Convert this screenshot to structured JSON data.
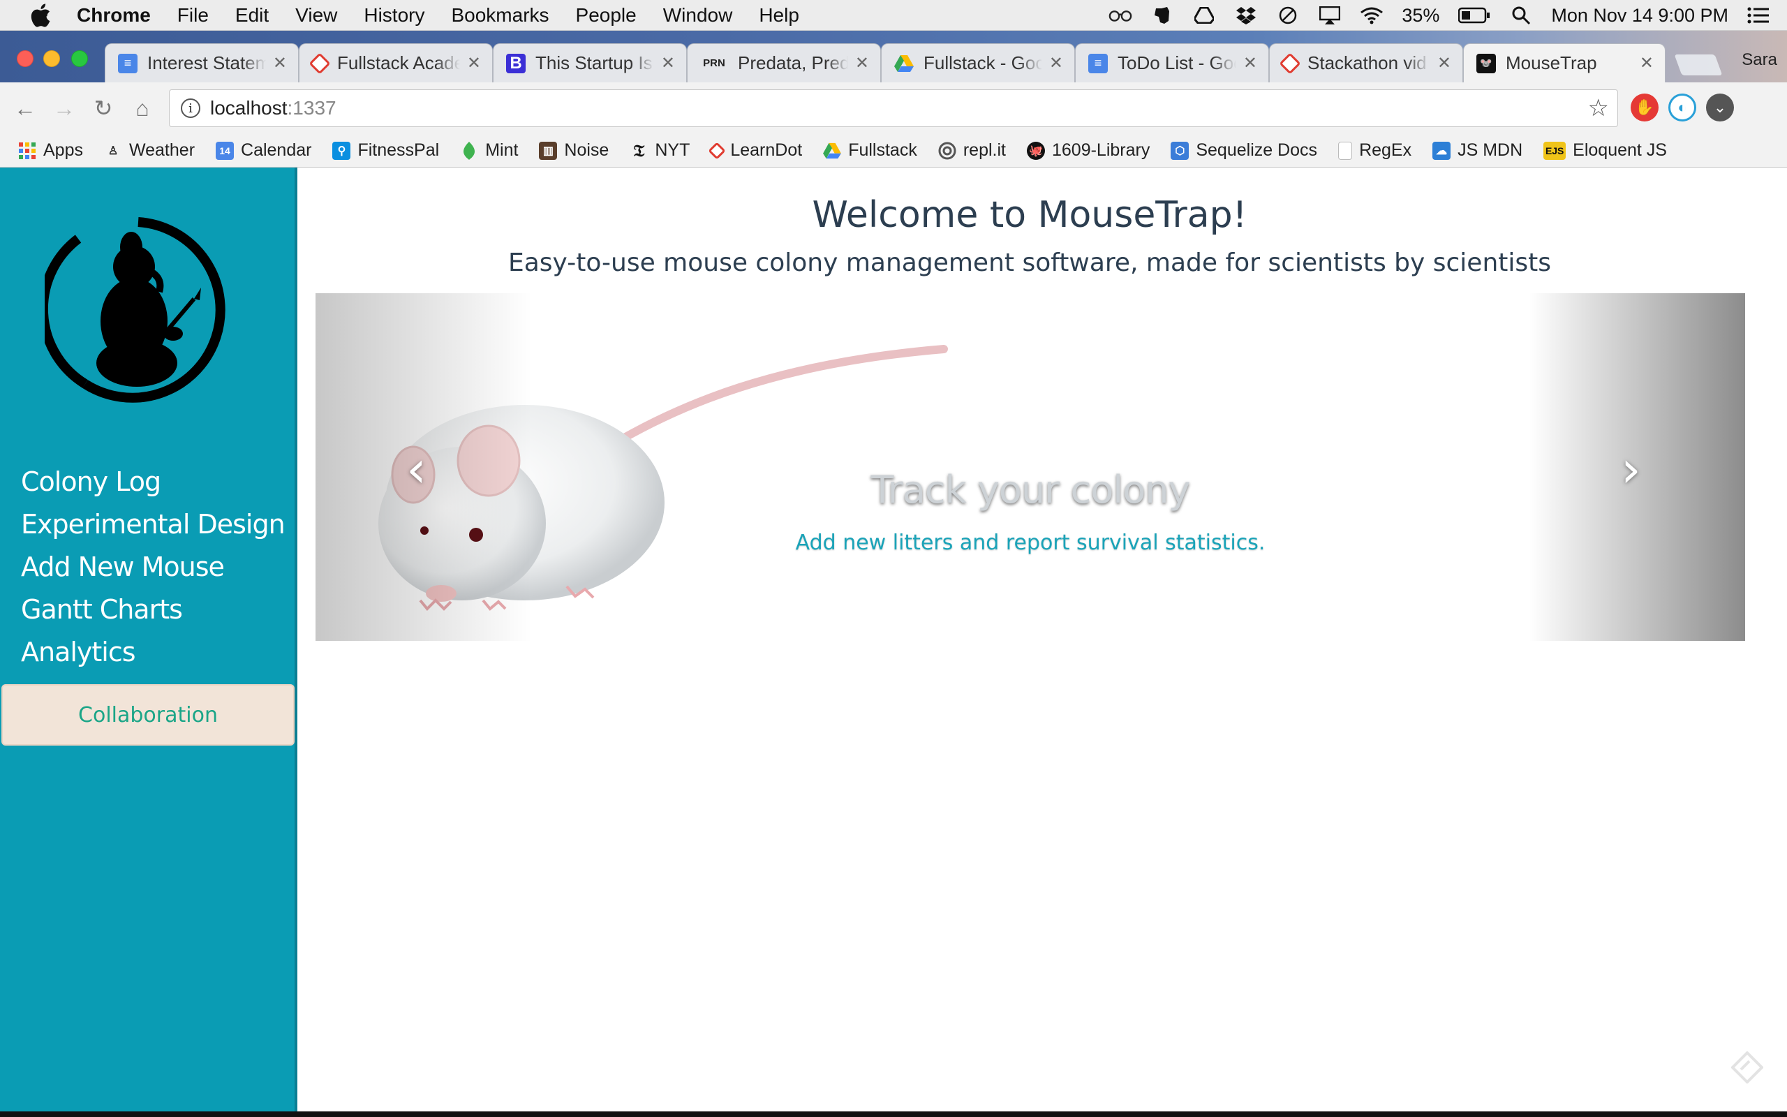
{
  "menubar": {
    "items": [
      "Chrome",
      "File",
      "Edit",
      "View",
      "History",
      "Bookmarks",
      "People",
      "Window",
      "Help"
    ],
    "battery": "35%",
    "clock": "Mon Nov 14  9:00 PM"
  },
  "tabs": [
    {
      "title": "Interest Statem",
      "favicon": "docs-icon",
      "color": "#4a86e8"
    },
    {
      "title": "Fullstack Acade",
      "favicon": "fullstack-icon",
      "color": "#e03c31"
    },
    {
      "title": "This Startup Is",
      "favicon": "b-icon",
      "color": "#3b2fd6"
    },
    {
      "title": "Predata, Predic",
      "favicon": "prn-icon",
      "color": "#333333"
    },
    {
      "title": "Fullstack - Goo",
      "favicon": "drive-icon",
      "color": "#34a853"
    },
    {
      "title": "ToDo List - Goo",
      "favicon": "docs-icon",
      "color": "#4a86e8"
    },
    {
      "title": "Stackathon vid",
      "favicon": "fullstack-icon",
      "color": "#e03c31"
    },
    {
      "title": "MouseTrap",
      "favicon": "mousetrap-icon",
      "color": "#111111"
    }
  ],
  "profile": "Sara",
  "url": {
    "host": "localhost",
    "port": ":1337"
  },
  "bookmarks": [
    {
      "label": "Apps",
      "icon": "apps-grid-icon",
      "color": "#e94235"
    },
    {
      "label": "Weather",
      "icon": "weather-icon",
      "color": "#222222"
    },
    {
      "label": "Calendar",
      "icon": "calendar-icon",
      "color": "#4a86e8",
      "badge": "14"
    },
    {
      "label": "FitnessPal",
      "icon": "fitnesspal-icon",
      "color": "#0a8fe0"
    },
    {
      "label": "Mint",
      "icon": "mint-icon",
      "color": "#3fb34f"
    },
    {
      "label": "Noise",
      "icon": "noise-icon",
      "color": "#5a3e2b"
    },
    {
      "label": "NYT",
      "icon": "nyt-icon",
      "color": "#111111"
    },
    {
      "label": "LearnDot",
      "icon": "learndot-icon",
      "color": "#e03c31"
    },
    {
      "label": "Fullstack",
      "icon": "drive-icon",
      "color": "#34a853"
    },
    {
      "label": "repl.it",
      "icon": "replit-icon",
      "color": "#555555"
    },
    {
      "label": "1609-Library",
      "icon": "github-icon",
      "color": "#111111"
    },
    {
      "label": "Sequelize Docs",
      "icon": "sequelize-icon",
      "color": "#3b7dd8"
    },
    {
      "label": "RegEx",
      "icon": "page-icon",
      "color": "#bbbbbb"
    },
    {
      "label": "JS MDN",
      "icon": "mdn-icon",
      "color": "#2c7fd6"
    },
    {
      "label": "Eloquent JS",
      "icon": "ejs-icon",
      "color": "#f0c419",
      "badge": "EJS"
    }
  ],
  "sidebar": {
    "nav": [
      "Colony Log",
      "Experimental Design",
      "Add New Mouse",
      "Gantt Charts",
      "Analytics"
    ],
    "active": "Collaboration"
  },
  "main": {
    "title": "Welcome to MouseTrap!",
    "subtitle": "Easy-to-use mouse colony management software, made for scientists by scientists",
    "carousel": {
      "title": "Track your colony",
      "subtitle": "Add new litters and report survival statistics.",
      "prev": "‹",
      "next": "›"
    }
  }
}
